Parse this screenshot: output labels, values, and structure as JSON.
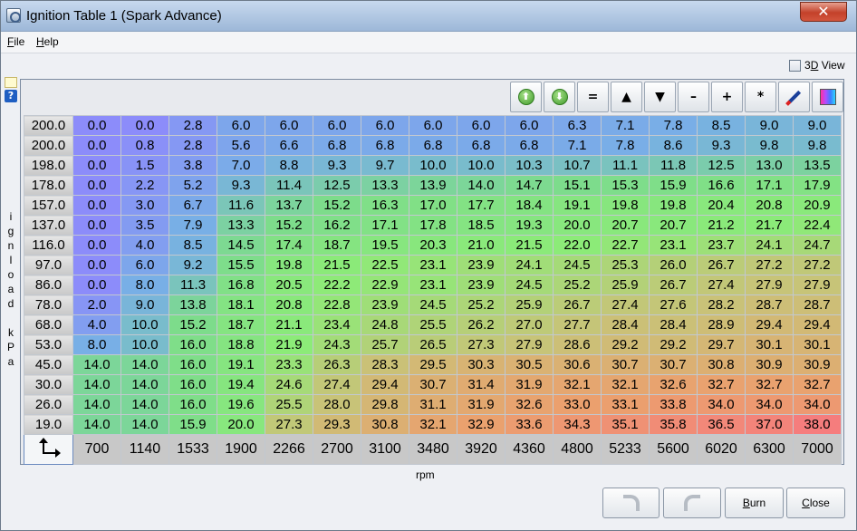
{
  "window": {
    "title": "Ignition Table 1 (Spark Advance)",
    "close_glyph": "✕"
  },
  "menu": {
    "file": "File",
    "file_mnemonic": "F",
    "file_rest": "ile",
    "help": "Help",
    "help_mnemonic": "H",
    "help_rest": "elp"
  },
  "view3d": {
    "label": "3D View",
    "label_mnemonic_prefix": "3",
    "label_mnemonic": "D",
    "label_rest": " View",
    "checked": false
  },
  "toolbar": {
    "buttons": [
      {
        "name": "shift-up-button",
        "icon": "green-up-arrow-icon",
        "glyph": "⬆"
      },
      {
        "name": "shift-down-button",
        "icon": "green-down-arrow-icon",
        "glyph": "⬇"
      },
      {
        "name": "set-equal-button",
        "icon": "equals-icon",
        "glyph": "="
      },
      {
        "name": "increment-button",
        "icon": "triangle-up-icon",
        "glyph": "▲"
      },
      {
        "name": "decrement-button",
        "icon": "triangle-down-icon",
        "glyph": "▼"
      },
      {
        "name": "subtract-button",
        "icon": "minus-icon",
        "glyph": "–"
      },
      {
        "name": "add-button",
        "icon": "plus-icon",
        "glyph": "+"
      },
      {
        "name": "multiply-button",
        "icon": "asterisk-icon",
        "glyph": "*"
      },
      {
        "name": "interpolate-button",
        "icon": "pen-icon",
        "glyph": ""
      },
      {
        "name": "color-map-button",
        "icon": "color-gradient-icon",
        "glyph": ""
      }
    ]
  },
  "table": {
    "y_axis_label": "ignload kPa",
    "x_axis_label": "rpm",
    "y_values": [
      "200.0",
      "200.0",
      "198.0",
      "178.0",
      "157.0",
      "137.0",
      "116.0",
      "97.0",
      "86.0",
      "78.0",
      "68.0",
      "53.0",
      "45.0",
      "30.0",
      "26.0",
      "19.0"
    ],
    "x_values": [
      "700",
      "1140",
      "1533",
      "1900",
      "2266",
      "2700",
      "3100",
      "3480",
      "3920",
      "4360",
      "4800",
      "5233",
      "5600",
      "6020",
      "6300",
      "7000"
    ],
    "rows": [
      [
        "0.0",
        "0.0",
        "2.8",
        "6.0",
        "6.0",
        "6.0",
        "6.0",
        "6.0",
        "6.0",
        "6.0",
        "6.3",
        "7.1",
        "7.8",
        "8.5",
        "9.0",
        "9.0"
      ],
      [
        "0.0",
        "0.8",
        "2.8",
        "5.6",
        "6.6",
        "6.8",
        "6.8",
        "6.8",
        "6.8",
        "6.8",
        "7.1",
        "7.8",
        "8.6",
        "9.3",
        "9.8",
        "9.8"
      ],
      [
        "0.0",
        "1.5",
        "3.8",
        "7.0",
        "8.8",
        "9.3",
        "9.7",
        "10.0",
        "10.0",
        "10.3",
        "10.7",
        "11.1",
        "11.8",
        "12.5",
        "13.0",
        "13.5"
      ],
      [
        "0.0",
        "2.2",
        "5.2",
        "9.3",
        "11.4",
        "12.5",
        "13.3",
        "13.9",
        "14.0",
        "14.7",
        "15.1",
        "15.3",
        "15.9",
        "16.6",
        "17.1",
        "17.9"
      ],
      [
        "0.0",
        "3.0",
        "6.7",
        "11.6",
        "13.7",
        "15.2",
        "16.3",
        "17.0",
        "17.7",
        "18.4",
        "19.1",
        "19.8",
        "19.8",
        "20.4",
        "20.8",
        "20.9"
      ],
      [
        "0.0",
        "3.5",
        "7.9",
        "13.3",
        "15.2",
        "16.2",
        "17.1",
        "17.8",
        "18.5",
        "19.3",
        "20.0",
        "20.7",
        "20.7",
        "21.2",
        "21.7",
        "22.4"
      ],
      [
        "0.0",
        "4.0",
        "8.5",
        "14.5",
        "17.4",
        "18.7",
        "19.5",
        "20.3",
        "21.0",
        "21.5",
        "22.0",
        "22.7",
        "23.1",
        "23.7",
        "24.1",
        "24.7"
      ],
      [
        "0.0",
        "6.0",
        "9.2",
        "15.5",
        "19.8",
        "21.5",
        "22.5",
        "23.1",
        "23.9",
        "24.1",
        "24.5",
        "25.3",
        "26.0",
        "26.7",
        "27.2",
        "27.2"
      ],
      [
        "0.0",
        "8.0",
        "11.3",
        "16.8",
        "20.5",
        "22.2",
        "22.9",
        "23.1",
        "23.9",
        "24.5",
        "25.2",
        "25.9",
        "26.7",
        "27.4",
        "27.9",
        "27.9"
      ],
      [
        "2.0",
        "9.0",
        "13.8",
        "18.1",
        "20.8",
        "22.8",
        "23.9",
        "24.5",
        "25.2",
        "25.9",
        "26.7",
        "27.4",
        "27.6",
        "28.2",
        "28.7",
        "28.7"
      ],
      [
        "4.0",
        "10.0",
        "15.2",
        "18.7",
        "21.1",
        "23.4",
        "24.8",
        "25.5",
        "26.2",
        "27.0",
        "27.7",
        "28.4",
        "28.4",
        "28.9",
        "29.4",
        "29.4"
      ],
      [
        "8.0",
        "10.0",
        "16.0",
        "18.8",
        "21.9",
        "24.3",
        "25.7",
        "26.5",
        "27.3",
        "27.9",
        "28.6",
        "29.2",
        "29.2",
        "29.7",
        "30.1",
        "30.1"
      ],
      [
        "14.0",
        "14.0",
        "16.0",
        "19.1",
        "23.3",
        "26.3",
        "28.3",
        "29.5",
        "30.3",
        "30.5",
        "30.6",
        "30.7",
        "30.7",
        "30.8",
        "30.9",
        "30.9"
      ],
      [
        "14.0",
        "14.0",
        "16.0",
        "19.4",
        "24.6",
        "27.4",
        "29.4",
        "30.7",
        "31.4",
        "31.9",
        "32.1",
        "32.1",
        "32.6",
        "32.7",
        "32.7",
        "32.7"
      ],
      [
        "14.0",
        "14.0",
        "16.0",
        "19.6",
        "25.5",
        "28.0",
        "29.8",
        "31.1",
        "31.9",
        "32.6",
        "33.0",
        "33.1",
        "33.8",
        "34.0",
        "34.0",
        "34.0"
      ],
      [
        "14.0",
        "14.0",
        "15.9",
        "20.0",
        "27.3",
        "29.3",
        "30.8",
        "32.1",
        "32.9",
        "33.6",
        "34.3",
        "35.1",
        "35.8",
        "36.5",
        "37.0",
        "38.0"
      ]
    ]
  },
  "buttons": {
    "burn": "Burn",
    "burn_mnemonic": "B",
    "burn_rest": "urn",
    "close": "Close",
    "close_mnemonic": "C",
    "close_rest": "lose"
  }
}
